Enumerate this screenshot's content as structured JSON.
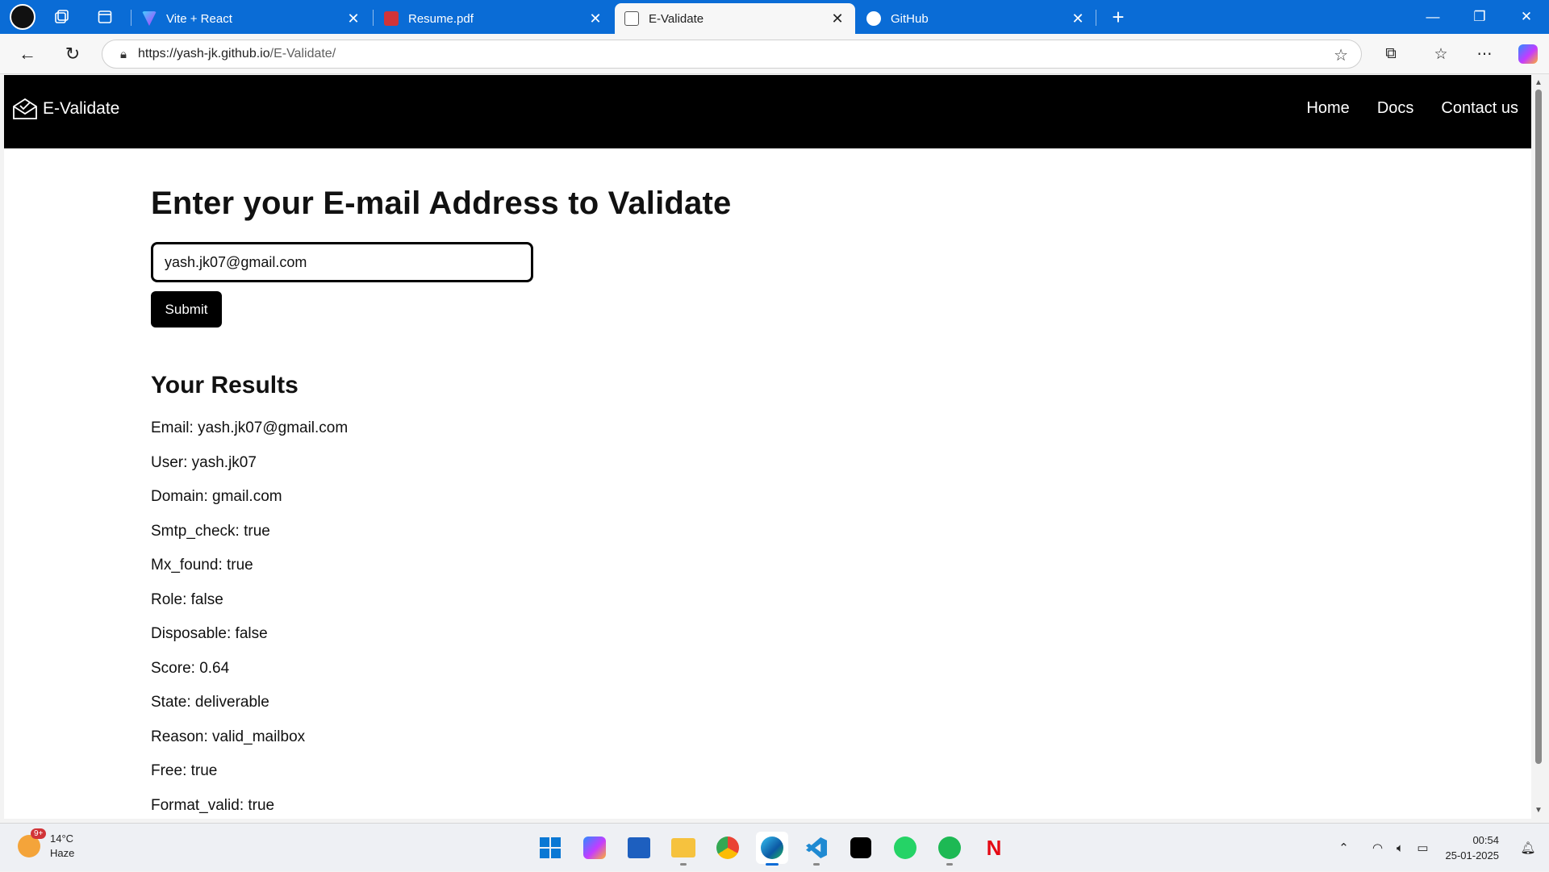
{
  "browser": {
    "tabs": [
      {
        "title": "Vite + React",
        "active": false
      },
      {
        "title": "Resume.pdf",
        "active": false
      },
      {
        "title": "E-Validate",
        "active": true
      },
      {
        "title": "GitHub",
        "active": false
      }
    ],
    "address": {
      "host": "https://yash-jk.github.io",
      "path": "/E-Validate/"
    }
  },
  "site": {
    "brand": "E-Validate",
    "nav": [
      "Home",
      "Docs",
      "Contact us"
    ],
    "headline": "Enter your E-mail Address to Validate",
    "email_value": "yash.jk07@gmail.com",
    "submit_label": "Submit",
    "results_title": "Your Results",
    "results": [
      "Email: yash.jk07@gmail.com",
      "User: yash.jk07",
      "Domain: gmail.com",
      "Smtp_check: true",
      "Mx_found: true",
      "Role: false",
      "Disposable: false",
      "Score: 0.64",
      "State: deliverable",
      "Reason: valid_mailbox",
      "Free: true",
      "Format_valid: true"
    ]
  },
  "taskbar": {
    "weather_temp": "14°C",
    "weather_desc": "Haze",
    "weather_badge": "9+",
    "time": "00:54",
    "date": "25-01-2025"
  },
  "colors": {
    "tabstrip": "#0a6cd6",
    "site_nav": "#000000",
    "accent": "#0a6cd6"
  }
}
